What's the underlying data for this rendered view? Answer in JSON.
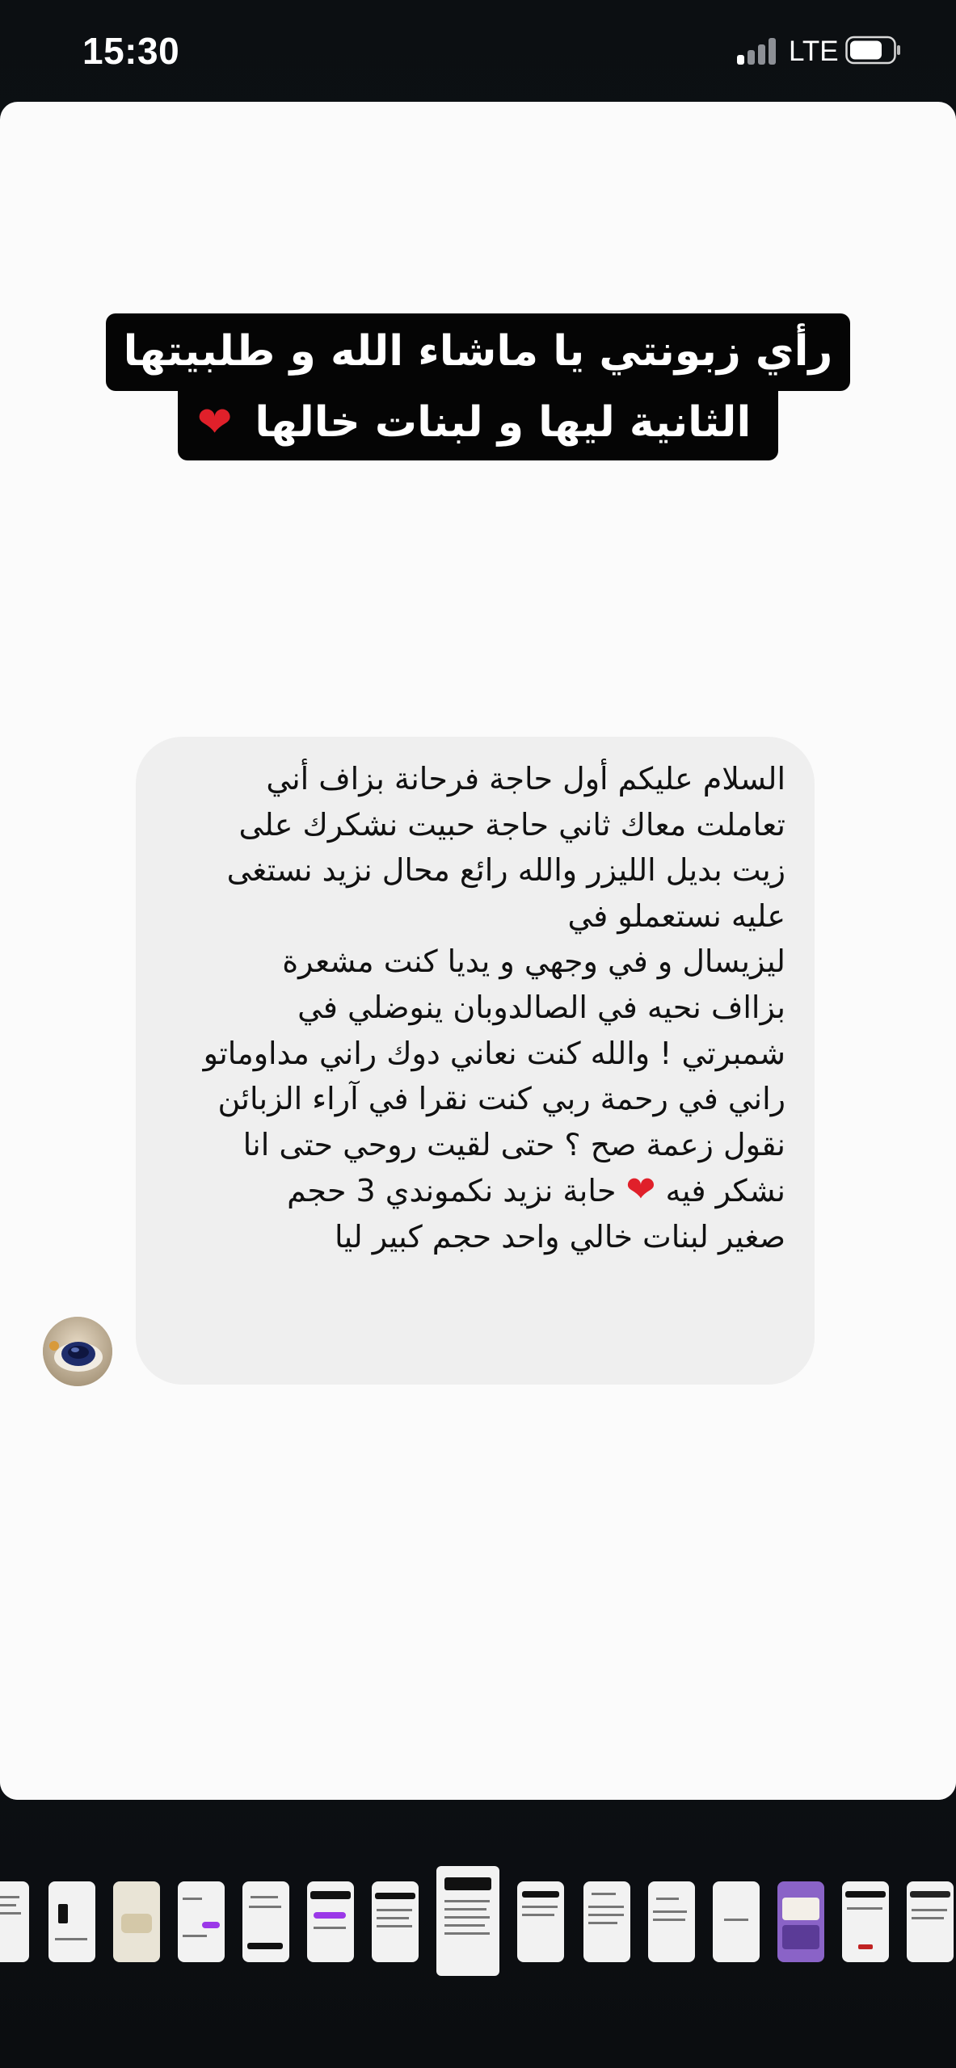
{
  "status_bar": {
    "time": "15:30",
    "network": "LTE",
    "icons": [
      "signal-icon",
      "battery-icon"
    ]
  },
  "story": {
    "title_lines": [
      "رأي زبونتي يا ماشاء الله و طلبيتها",
      "الثانية ليها و لبنات خالها"
    ],
    "title_emoji": "❤️",
    "message_lines": [
      "السلام عليكم أول حاجة فرحانة بزاف أني",
      "تعاملت معاك ثاني حاجة حبيت نشكرك على",
      "زيت بديل الليزر والله رائع محال نزيد نستغى",
      "عليه نستعملو في",
      "ليزيسال و في وجهي و يديا كنت مشعرة",
      "بزااف نحيه في الصالدوبان ينوضلي في",
      "شمبرتي ! والله كنت نعاني دوك راني مداوماتو",
      "راني في رحمة ربي كنت نقرا في آراء الزبائن",
      "نقول زعمة صح ؟ حتى لقيت روحي حتى انا",
      "نشكر فيه ❤️ حابة نزيد نكموندي 3 حجم",
      "صغير لبنات خالي واحد حجم كبير ليا"
    ],
    "avatar_icon": "avatar"
  },
  "thumbnails": {
    "count": 15,
    "active_index": 7
  },
  "colors": {
    "background": "#0d0f12",
    "card": "#fbfbfb",
    "bubble": "#efefef",
    "title_bg": "#050505",
    "heart": "#e0202a"
  }
}
